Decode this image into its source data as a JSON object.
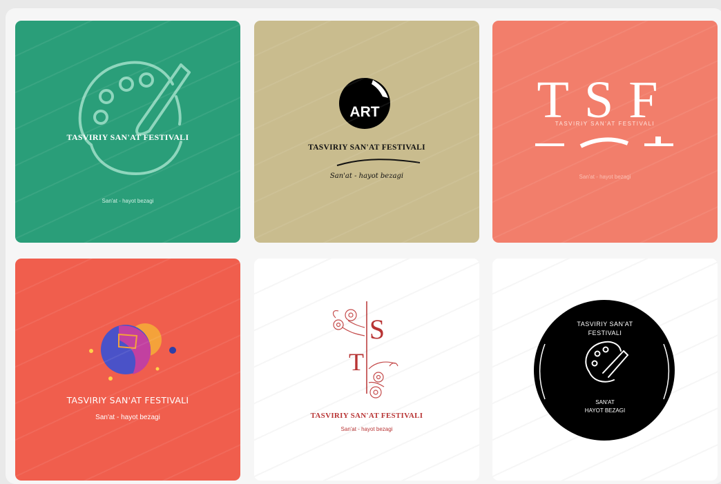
{
  "colors": {
    "green": "#2a9e79",
    "khaki": "#c9bc8e",
    "salmon": "#f27e6b",
    "coral": "#f05e4d",
    "white": "#ffffff",
    "black": "#000000",
    "dark_red": "#b83434"
  },
  "cards": [
    {
      "title": "TASVIRIY SAN'AT FESTIVALI",
      "tagline": "San'at - hayot bezagi",
      "icon": "palette-brush-icon"
    },
    {
      "badge": "ART",
      "title": "TASVIRIY SAN'AT FESTIVALI",
      "tagline": "San'at - hayot bezagi",
      "icon": "art-circle-icon"
    },
    {
      "monogram": "TSF",
      "title": "TASVIRIY SAN'AT FESTIVALI",
      "tagline": "San'at - hayot bezagi"
    },
    {
      "title": "TASVIRIY SAN'AT FESTIVALI",
      "tagline": "San'at - hayot bezagi",
      "icon": "abstract-face-icon"
    },
    {
      "monogram_s": "S",
      "monogram_t": "T",
      "title": "TASVIRIY SAN'AT FESTIVALI",
      "tagline": "San'at - hayot bezagi",
      "icon": "floral-branch-icon"
    },
    {
      "title_line1": "TASVIRIY SAN'AT",
      "title_line2": "FESTIVALI",
      "tagline_line1": "SAN'AT",
      "tagline_line2": "HAYOT BEZAGI",
      "icon": "palette-brush-icon"
    }
  ]
}
